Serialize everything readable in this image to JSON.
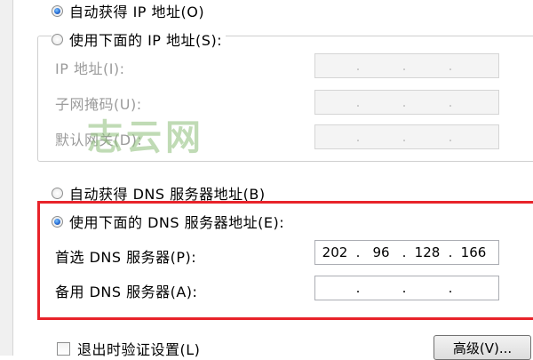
{
  "ip_section": {
    "auto_ip_label": "自动获得 IP 地址(O)",
    "manual_ip_label": "使用下面的 IP 地址(S):",
    "ip_address_label": "IP 地址(I):",
    "subnet_mask_label": "子网掩码(U):",
    "gateway_label": "默认网关(D):"
  },
  "dns_section": {
    "auto_dns_label": "自动获得 DNS 服务器地址(B)",
    "manual_dns_label": "使用下面的 DNS 服务器地址(E):",
    "preferred_dns_label": "首选 DNS 服务器(P):",
    "preferred_dns_octets": [
      "202",
      "96",
      "128",
      "166"
    ],
    "alternate_dns_label": "备用 DNS 服务器(A):"
  },
  "footer": {
    "validate_label": "退出时验证设置(L)",
    "advanced_button_label": "高级(V)..."
  },
  "watermark": {
    "text": "志云网",
    "color": "#8cbe78"
  },
  "colors": {
    "highlight_border": "#e8232a",
    "radio_selected": "#2b6fd6"
  }
}
